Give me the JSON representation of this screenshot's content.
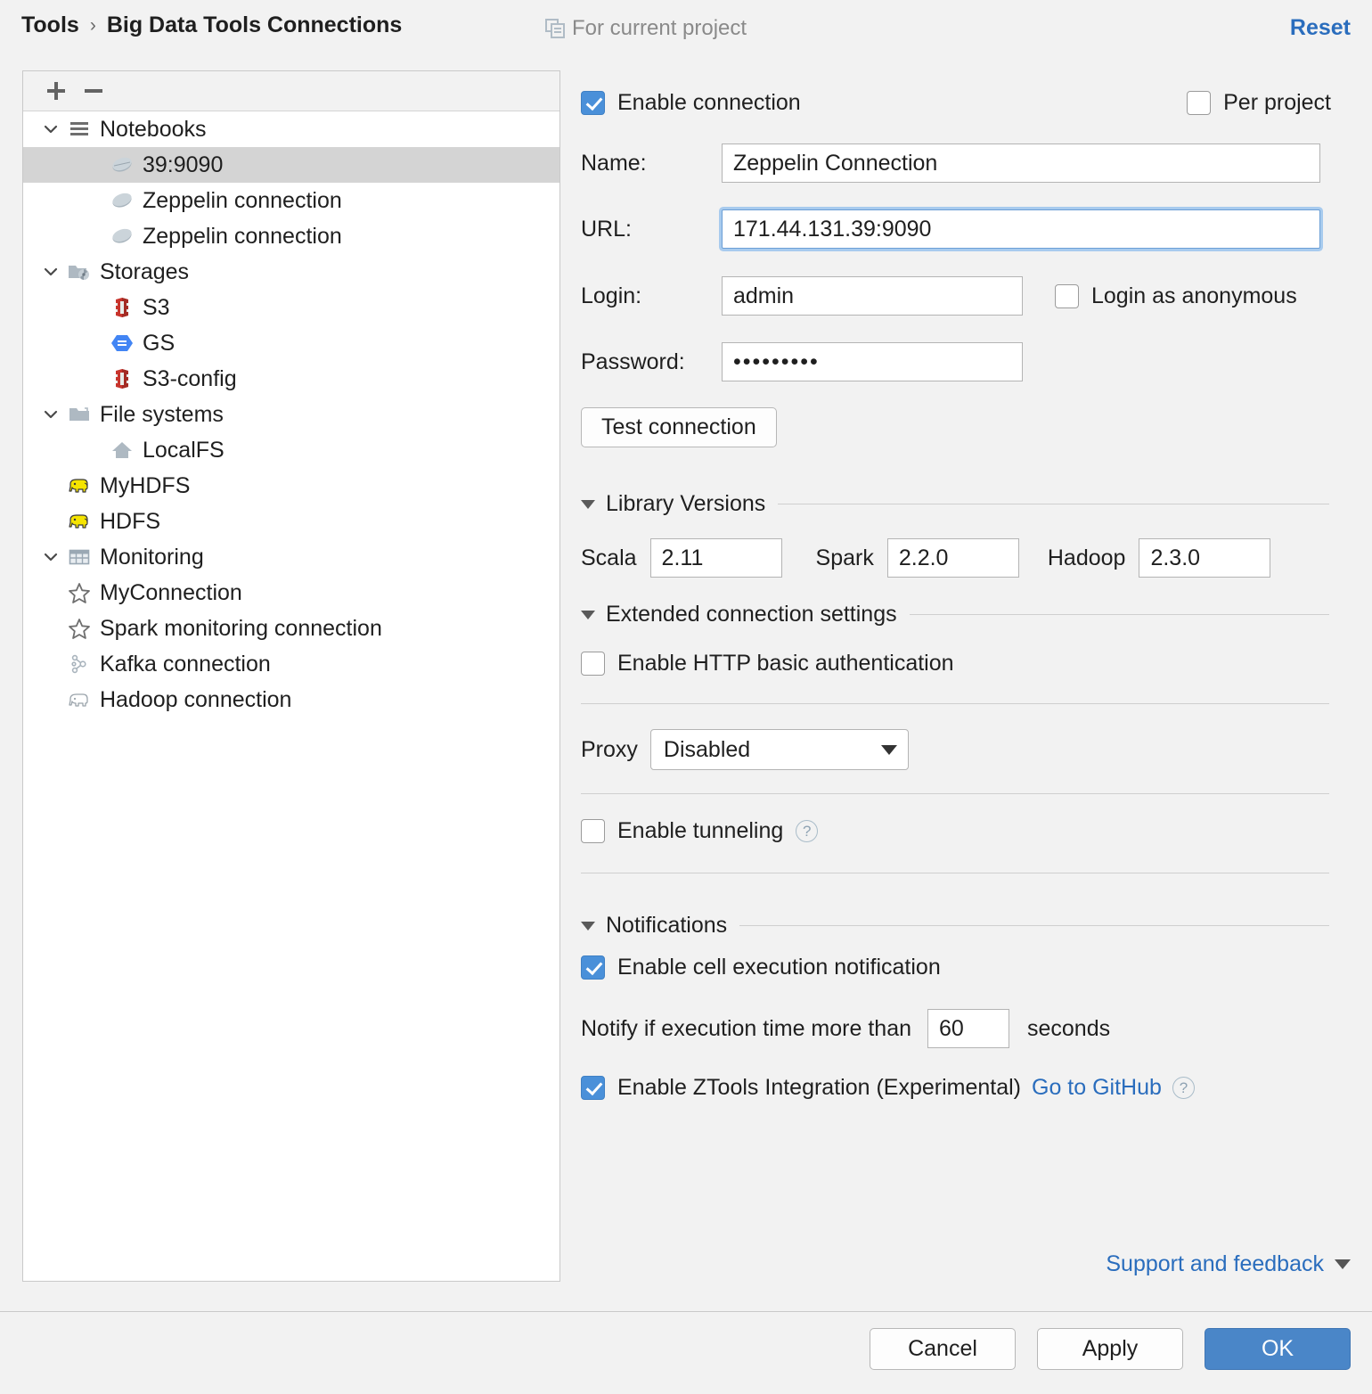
{
  "header": {
    "breadcrumb_root": "Tools",
    "breadcrumb_separator": "›",
    "breadcrumb_current": "Big Data Tools Connections",
    "project_scope": "For current project",
    "reset_label": "Reset"
  },
  "tree": {
    "toolbar": {
      "add_label": "+",
      "remove_label": "−"
    },
    "items": [
      {
        "label": "Notebooks",
        "icon": "notebooks-icon",
        "level": 0,
        "expanded": true,
        "selected": false
      },
      {
        "label": "39:9090",
        "icon": "zeppelin-icon",
        "level": 1,
        "expanded": null,
        "selected": true
      },
      {
        "label": "Zeppelin connection",
        "icon": "zeppelin-icon",
        "level": 1,
        "expanded": null,
        "selected": false
      },
      {
        "label": "Zeppelin connection",
        "icon": "zeppelin-icon",
        "level": 1,
        "expanded": null,
        "selected": false
      },
      {
        "label": "Storages",
        "icon": "storages-icon",
        "level": 0,
        "expanded": true,
        "selected": false
      },
      {
        "label": "S3",
        "icon": "s3-icon",
        "level": 1,
        "expanded": null,
        "selected": false
      },
      {
        "label": "GS",
        "icon": "gs-icon",
        "level": 1,
        "expanded": null,
        "selected": false
      },
      {
        "label": "S3-config",
        "icon": "s3-icon",
        "level": 1,
        "expanded": null,
        "selected": false
      },
      {
        "label": "File systems",
        "icon": "folder-icon",
        "level": 0,
        "expanded": true,
        "selected": false
      },
      {
        "label": "LocalFS",
        "icon": "home-icon",
        "level": 1,
        "expanded": null,
        "selected": false
      },
      {
        "label": "MyHDFS",
        "icon": "hdfs-elephant-icon",
        "level": 1,
        "expanded": null,
        "selected": false
      },
      {
        "label": "HDFS",
        "icon": "hdfs-elephant-icon",
        "level": 1,
        "expanded": null,
        "selected": false
      },
      {
        "label": "Monitoring",
        "icon": "monitoring-table-icon",
        "level": 0,
        "expanded": true,
        "selected": false
      },
      {
        "label": "MyConnection",
        "icon": "star-icon",
        "level": 1,
        "expanded": null,
        "selected": false
      },
      {
        "label": "Spark monitoring connection",
        "icon": "star-icon",
        "level": 1,
        "expanded": null,
        "selected": false
      },
      {
        "label": "Kafka connection",
        "icon": "kafka-icon",
        "level": 1,
        "expanded": null,
        "selected": false
      },
      {
        "label": "Hadoop connection",
        "icon": "hadoop-elephant-icon",
        "level": 1,
        "expanded": null,
        "selected": false
      }
    ]
  },
  "form": {
    "enable_connection_label": "Enable connection",
    "enable_connection_checked": true,
    "per_project_label": "Per project",
    "per_project_checked": false,
    "name_label": "Name:",
    "name_value": "Zeppelin Connection",
    "url_label": "URL:",
    "url_value": "171.44.131.39:9090",
    "login_label": "Login:",
    "login_value": "admin",
    "login_anonymous_label": "Login as anonymous",
    "login_anonymous_checked": false,
    "password_label": "Password:",
    "password_value": "•••••••••",
    "test_connection_label": "Test connection",
    "library_versions": {
      "title": "Library Versions",
      "scala_label": "Scala",
      "scala_value": "2.11",
      "spark_label": "Spark",
      "spark_value": "2.2.0",
      "hadoop_label": "Hadoop",
      "hadoop_value": "2.3.0"
    },
    "extended": {
      "title": "Extended connection settings",
      "http_basic_label": "Enable HTTP basic authentication",
      "http_basic_checked": false,
      "proxy_label": "Proxy",
      "proxy_value": "Disabled",
      "proxy_options": [
        "Disabled"
      ],
      "tunneling_label": "Enable tunneling",
      "tunneling_checked": false,
      "tunneling_help": "?"
    },
    "notifications": {
      "title": "Notifications",
      "cell_exec_label": "Enable cell execution notification",
      "cell_exec_checked": true,
      "notify_prefix": "Notify if execution time more than",
      "notify_seconds": "60",
      "notify_suffix": "seconds",
      "ztools_label": "Enable ZTools Integration (Experimental)",
      "ztools_checked": true,
      "ztools_link": "Go to GitHub",
      "ztools_help": "?"
    },
    "support_label": "Support and feedback"
  },
  "footer": {
    "cancel_label": "Cancel",
    "apply_label": "Apply",
    "ok_label": "OK"
  },
  "colors": {
    "accent_blue": "#4a90d9",
    "link_blue": "#2a6dbd",
    "ok_button": "#4a86c8",
    "selection_gray": "#d4d4d4",
    "panel_bg": "#f2f2f2"
  }
}
